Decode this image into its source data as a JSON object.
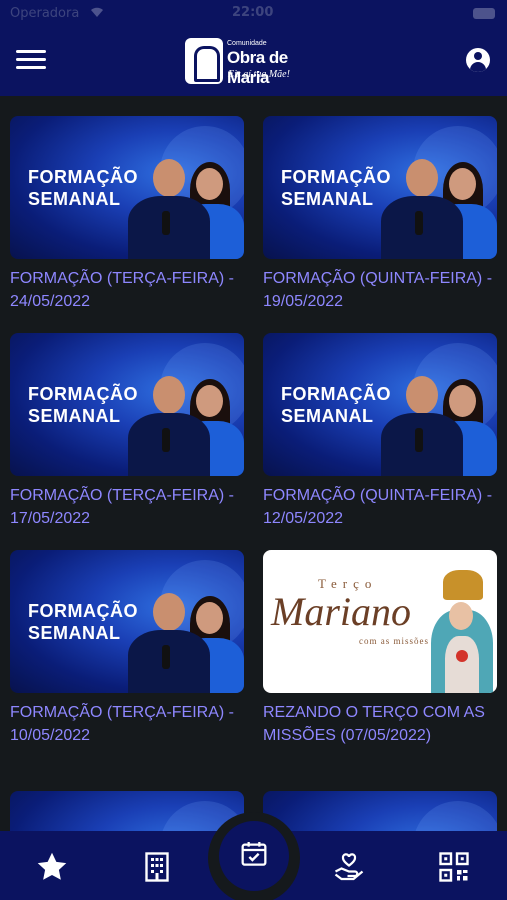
{
  "status": {
    "carrier": "Operadora",
    "time": "22:00"
  },
  "header": {
    "logo_small": "Comunidade",
    "logo_main": "Obra de Maria",
    "logo_sub": "Eis aí tua Mãe!"
  },
  "thumbnail_text": {
    "formacao_line1": "FORMAÇÃO",
    "formacao_line2": "SEMANAL",
    "terco_small": "Terço",
    "terco_main": "Mariano",
    "terco_sub": "com as missões"
  },
  "cards": [
    {
      "title": "FORMAÇÃO (TERÇA-FEIRA) - 24/05/2022",
      "type": "formacao"
    },
    {
      "title": "FORMAÇÃO (QUINTA-FEIRA) - 19/05/2022",
      "type": "formacao"
    },
    {
      "title": "FORMAÇÃO (TERÇA-FEIRA) - 17/05/2022",
      "type": "formacao"
    },
    {
      "title": "FORMAÇÃO (QUINTA-FEIRA) - 12/05/2022",
      "type": "formacao"
    },
    {
      "title": "FORMAÇÃO (TERÇA-FEIRA) - 10/05/2022",
      "type": "formacao"
    },
    {
      "title": "REZANDO O TERÇO COM AS MISSÕES (07/05/2022)",
      "type": "terco"
    }
  ],
  "tabbar": {
    "items": [
      "star-icon",
      "building-icon",
      "calendar-check-icon",
      "hand-heart-icon",
      "qr-code-icon"
    ]
  },
  "colors": {
    "nav_bg": "#0b1360",
    "page_bg": "#15191c",
    "title_text": "#8e87ff"
  }
}
